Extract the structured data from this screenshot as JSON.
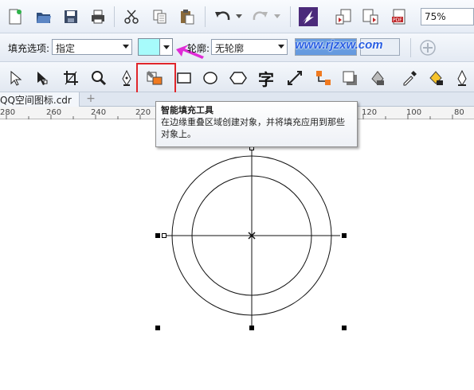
{
  "toolbar_standard": {
    "icons": [
      "new-icon",
      "open-icon",
      "save-icon",
      "print-icon",
      "cut-icon",
      "copy-icon",
      "paste-icon",
      "undo-icon",
      "redo-icon",
      "launcher-icon",
      "import-icon",
      "export-icon",
      "publish-pdf-icon"
    ],
    "zoom_value": "75%"
  },
  "property_bar": {
    "fill_option_label": "填充选项:",
    "fill_option_value": "指定",
    "fill_color": "#a7fbfb",
    "outline_label": "轮廓:",
    "outline_value": "无轮廓",
    "watermark": "www.rjzxw.com"
  },
  "toolbox": {
    "tools": [
      "pick-tool",
      "shape-tool",
      "crop-tool",
      "zoom-tool",
      "freehand-tool",
      "smart-fill-tool",
      "rectangle-tool",
      "ellipse-tool",
      "polygon-tool",
      "text-tool",
      "parallel-dimension-tool",
      "connector-tool",
      "drop-shadow-tool",
      "transparency-tool",
      "eyedropper-tool",
      "interactive-fill-tool",
      "smart-drawing-tool"
    ],
    "text_tool_glyph": "字",
    "highlight_color": "#e0262b",
    "arrow_color": "#e02bd6"
  },
  "document_tab": {
    "label": "QQ空间图标.cdr",
    "add_label": "+"
  },
  "ruler": {
    "labels": [
      "280",
      "260",
      "240",
      "220",
      "120",
      "100",
      "80"
    ]
  },
  "tooltip": {
    "title": "智能填充工具",
    "description": "在边缘重叠区域创建对象，并将填充应用到那些对象上。"
  }
}
